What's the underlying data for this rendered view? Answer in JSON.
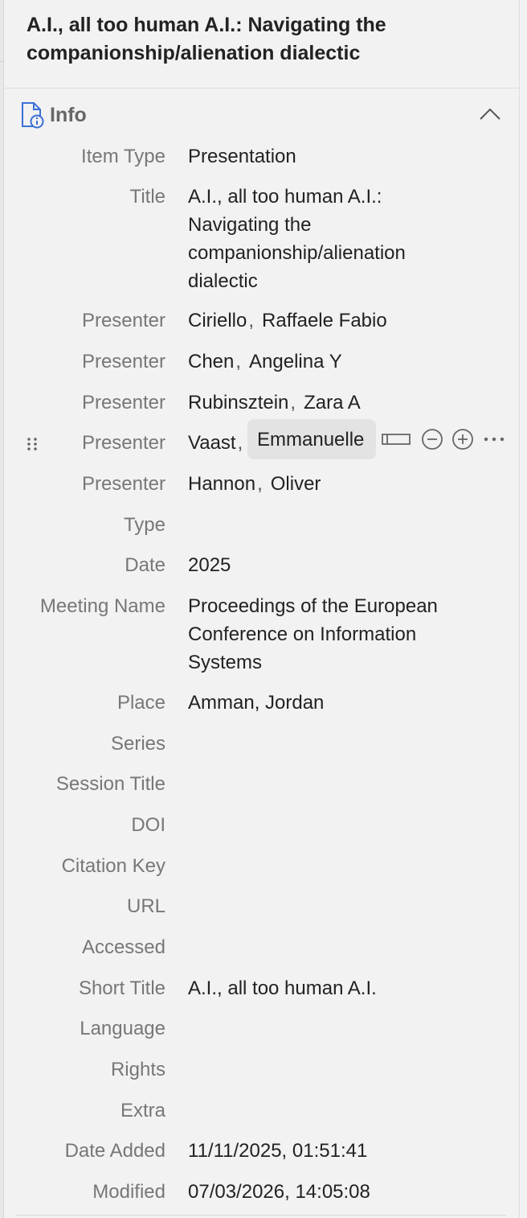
{
  "item": {
    "title": "A.I., all too human A.I.: Navigating the companionship/alienation dialectic"
  },
  "section": {
    "label": "Info"
  },
  "fields": {
    "item_type": {
      "label": "Item Type",
      "value": "Presentation"
    },
    "title": {
      "label": "Title",
      "value_lines": [
        "A.I., all too human A.I.:",
        "Navigating the",
        "companionship/alienation",
        "dialectic"
      ]
    },
    "presenters": [
      {
        "label": "Presenter",
        "last": "Ciriello",
        "first": "Raffaele Fabio"
      },
      {
        "label": "Presenter",
        "last": "Chen",
        "first": "Angelina Y"
      },
      {
        "label": "Presenter",
        "last": "Rubinsztein",
        "first": "Zara A"
      },
      {
        "label": "Presenter",
        "last": "Vaast",
        "first": "Emmanuelle"
      },
      {
        "label": "Presenter",
        "last": "Hannon",
        "first": "Oliver"
      }
    ],
    "type": {
      "label": "Type",
      "value": ""
    },
    "date": {
      "label": "Date",
      "value": "2025"
    },
    "meeting_name": {
      "label": "Meeting Name",
      "value_lines": [
        "Proceedings of the European",
        "Conference on Information",
        "Systems"
      ]
    },
    "place": {
      "label": "Place",
      "value": "Amman, Jordan"
    },
    "series": {
      "label": "Series",
      "value": ""
    },
    "session_title": {
      "label": "Session Title",
      "value": ""
    },
    "doi": {
      "label": "DOI",
      "value": ""
    },
    "citation_key": {
      "label": "Citation Key",
      "value": ""
    },
    "url": {
      "label": "URL",
      "value": ""
    },
    "accessed": {
      "label": "Accessed",
      "value": ""
    },
    "short_title": {
      "label": "Short Title",
      "value": "A.I., all too human A.I."
    },
    "language": {
      "label": "Language",
      "value": ""
    },
    "rights": {
      "label": "Rights",
      "value": ""
    },
    "extra": {
      "label": "Extra",
      "value": ""
    },
    "date_added": {
      "label": "Date Added",
      "value": "11/11/2025, 01:51:41"
    },
    "modified": {
      "label": "Modified",
      "value": "07/03/2026, 14:05:08"
    }
  },
  "separator": ",",
  "icons": {
    "section": "info-document-icon",
    "collapse": "chevron-up-icon",
    "drag": "drag-handle-icon",
    "swap": "field-mode-icon",
    "remove": "minus-circle-icon",
    "add": "plus-circle-icon",
    "more": "ellipsis-icon"
  },
  "colors": {
    "accent": "#3b6fd8",
    "background": "#f2f2f2",
    "label": "#777777",
    "value": "#222222"
  }
}
